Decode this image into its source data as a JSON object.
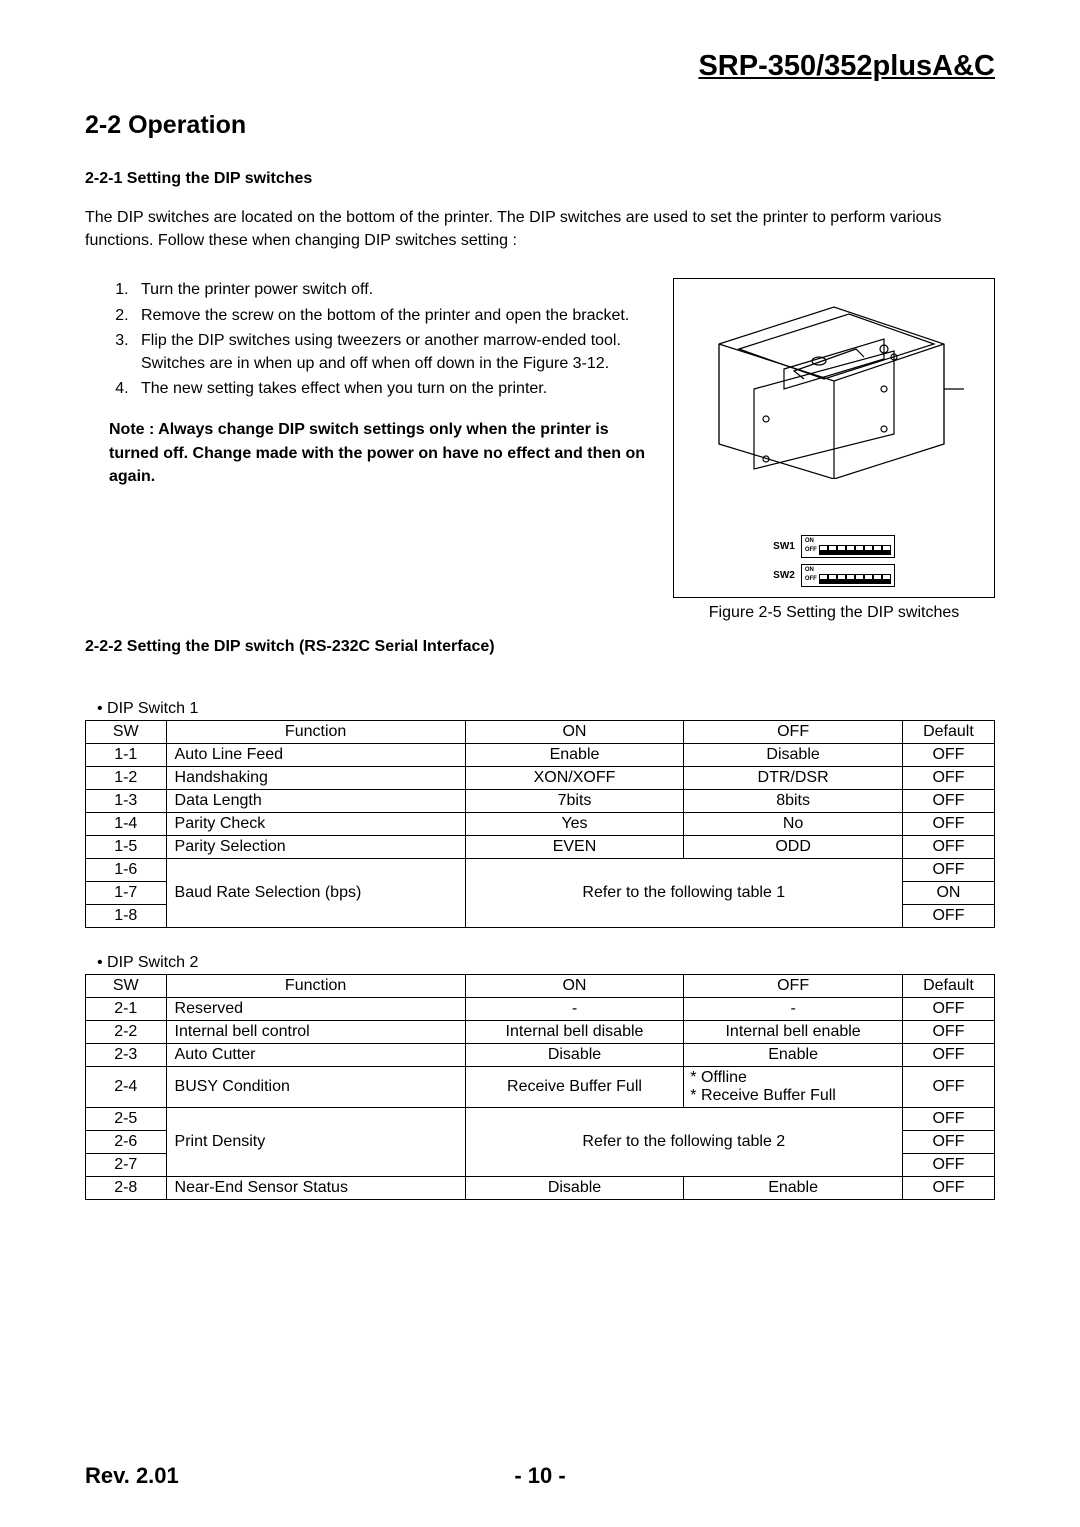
{
  "header": {
    "title": "SRP-350/352plusA&C"
  },
  "section": {
    "title": "2-2 Operation"
  },
  "sub1": {
    "title": "2-2-1 Setting the DIP switches"
  },
  "intro": "The DIP switches are located on the bottom of the printer. The DIP switches are used to set the printer to perform various functions. Follow these when changing DIP switches setting :",
  "steps": [
    "Turn the printer power switch off.",
    "Remove the screw on the bottom of the printer and open the bracket.",
    "Flip the DIP switches using tweezers or another marrow-ended tool. Switches are in when up and off when off down in the Figure 3-12.",
    "The new setting takes effect when you turn on the printer."
  ],
  "note": "Note : Always change DIP switch settings only when the printer is turned off. Change made with the power on have no effect and then on again.",
  "figure": {
    "sw1": "SW1",
    "sw2": "SW2",
    "on": "ON",
    "off": "OFF",
    "caption": "Figure 2-5 Setting the DIP switches"
  },
  "sub2": {
    "title": "2-2-2 Setting the DIP switch (RS-232C Serial Interface)"
  },
  "dip1": {
    "label": "• DIP Switch 1",
    "headers": {
      "sw": "SW",
      "fn": "Function",
      "on": "ON",
      "off": "OFF",
      "def": "Default"
    },
    "rows": [
      {
        "sw": "1-1",
        "fn": "Auto Line Feed",
        "on": "Enable",
        "off": "Disable",
        "def": "OFF"
      },
      {
        "sw": "1-2",
        "fn": "Handshaking",
        "on": "XON/XOFF",
        "off": "DTR/DSR",
        "def": "OFF"
      },
      {
        "sw": "1-3",
        "fn": "Data Length",
        "on": "7bits",
        "off": "8bits",
        "def": "OFF"
      },
      {
        "sw": "1-4",
        "fn": "Parity Check",
        "on": "Yes",
        "off": "No",
        "def": "OFF"
      },
      {
        "sw": "1-5",
        "fn": "Parity Selection",
        "on": "EVEN",
        "off": "ODD",
        "def": "OFF"
      }
    ],
    "merged": {
      "sw6": "1-6",
      "sw7": "1-7",
      "sw8": "1-8",
      "fn": "Baud Rate Selection (bps)",
      "note": "Refer to the following table 1",
      "def6": "OFF",
      "def7": "ON",
      "def8": "OFF"
    }
  },
  "dip2": {
    "label": "• DIP Switch 2",
    "headers": {
      "sw": "SW",
      "fn": "Function",
      "on": "ON",
      "off": "OFF",
      "def": "Default"
    },
    "rows": [
      {
        "sw": "2-1",
        "fn": "Reserved",
        "on": "-",
        "off": "-",
        "def": "OFF"
      },
      {
        "sw": "2-2",
        "fn": "Internal bell control",
        "on": "Internal bell disable",
        "off": "Internal bell enable",
        "def": "OFF"
      },
      {
        "sw": "2-3",
        "fn": "Auto Cutter",
        "on": "Disable",
        "off": "Enable",
        "def": "OFF"
      }
    ],
    "row4": {
      "sw": "2-4",
      "fn": "BUSY Condition",
      "on": "Receive Buffer Full",
      "off": "* Offline\n* Receive Buffer Full",
      "def": "OFF"
    },
    "merged": {
      "sw5": "2-5",
      "sw6": "2-6",
      "sw7": "2-7",
      "fn": "Print Density",
      "note": "Refer to the following table 2",
      "def5": "OFF",
      "def6": "OFF",
      "def7": "OFF"
    },
    "row8": {
      "sw": "2-8",
      "fn": "Near-End Sensor Status",
      "on": "Disable",
      "off": "Enable",
      "def": "OFF"
    }
  },
  "footer": {
    "rev": "Rev. 2.01",
    "page": "- 10 -"
  }
}
